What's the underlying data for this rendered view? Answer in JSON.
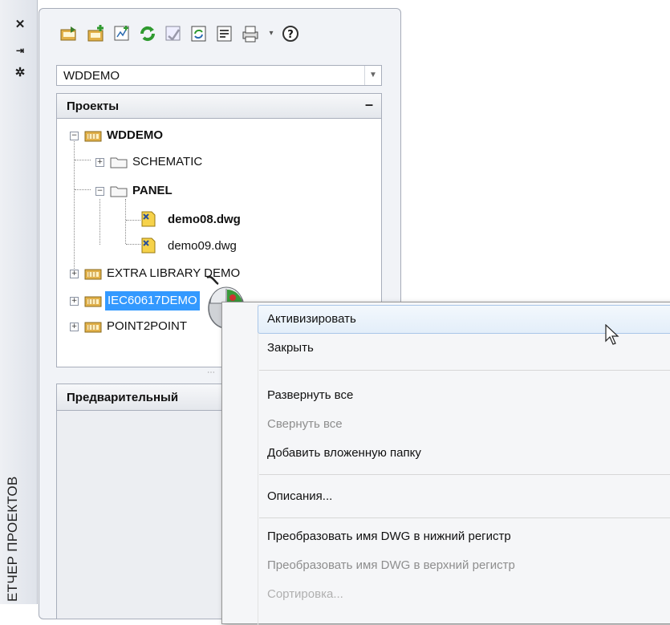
{
  "side_strip": {
    "vertical_label": "ЕТЧЕР ПРОЕКТОВ",
    "buttons": [
      "close-icon",
      "autohide-icon",
      "properties-icon"
    ]
  },
  "toolbar": {
    "icons": [
      "open-project-icon",
      "new-project-icon",
      "new-drawing-icon",
      "refresh-icon",
      "project-tasks-icon",
      "project-properties-icon",
      "drawing-properties-icon",
      "plot-icon",
      "dropdown-icon",
      "help-icon"
    ]
  },
  "project_combo": {
    "value": "WDDEMO"
  },
  "projects_section": {
    "title": "Проекты",
    "collapse_symbol": "–",
    "tree": {
      "wddemo": "WDDEMO",
      "schematic": "SCHEMATIC",
      "panel": "PANEL",
      "demo08": "demo08.dwg",
      "demo09": "demo09.dwg",
      "extra": "EXTRA LIBRARY DEMO",
      "iec": "IEC60617DEMO",
      "p2p": "POINT2POINT"
    }
  },
  "preview_section": {
    "title": "Предварительный"
  },
  "context_menu": {
    "items": [
      {
        "label": "Активизировать",
        "enabled": true
      },
      {
        "label": "Закрыть",
        "enabled": true
      },
      {
        "label": "Развернуть все",
        "enabled": true
      },
      {
        "label": "Свернуть все",
        "enabled": false
      },
      {
        "label": "Добавить вложенную папку",
        "enabled": true
      },
      {
        "label": "Описания...",
        "enabled": true
      },
      {
        "label": "Преобразовать имя DWG в нижний регистр",
        "enabled": true
      },
      {
        "label": "Преобразовать имя DWG в верхний регистр",
        "enabled": false
      },
      {
        "label": "Сортировка...",
        "enabled": false
      }
    ]
  },
  "colors": {
    "selection": "#3399ff",
    "menu_highlight_border": "#a9c6e8",
    "folder": "#f5d36a",
    "project_icon": "#e2b14a"
  }
}
